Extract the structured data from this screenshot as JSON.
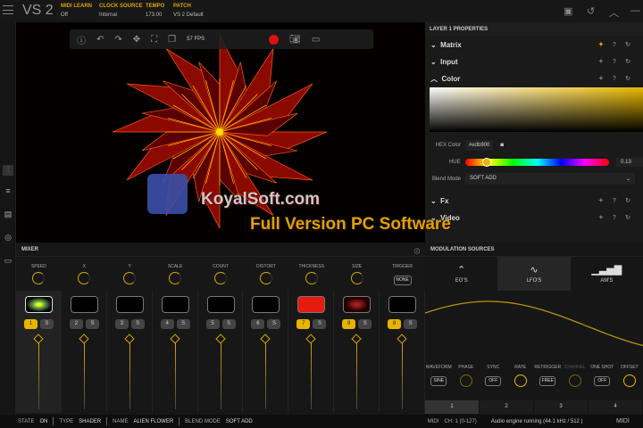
{
  "app": {
    "title": "VS 2"
  },
  "topbar": {
    "fields": [
      {
        "key": "MIDI LEARN",
        "value": "Off"
      },
      {
        "key": "CLOCK SOURCE",
        "value": "Internal"
      },
      {
        "key": "TEMPO",
        "value": "173.00"
      },
      {
        "key": "PATCH",
        "value": "VS 2 Default"
      }
    ]
  },
  "viewport": {
    "fps": "57 FPS",
    "accent": "#ffb300"
  },
  "watermark": {
    "line1": "KoyalSoft.com",
    "line2": "Full Version PC Software"
  },
  "properties": {
    "title": "LAYER 1 PROPERTIES",
    "sections": [
      "Matrix",
      "Input",
      "Color"
    ],
    "hex_label": "HEX Color",
    "hex_value": "#edb900",
    "hue_label": "HUE",
    "hue_value": "0.13",
    "blend_label": "Blend Mode",
    "blend_value": "SOFT ADD",
    "lower_sections": [
      "Fx",
      "Video"
    ]
  },
  "mixer": {
    "title": "MIXER",
    "knobs": [
      "SPEED",
      "X",
      "Y",
      "SCALE",
      "COUNT",
      "DISTORT",
      "THICKNESS",
      "SIZE"
    ],
    "trigger_label": "TRIGGER",
    "trigger_value": "NONE",
    "channels": [
      {
        "num": "1",
        "solo": "S",
        "active": true
      },
      {
        "num": "2",
        "solo": "S",
        "active": false
      },
      {
        "num": "3",
        "solo": "S",
        "active": false
      },
      {
        "num": "4",
        "solo": "S",
        "active": false
      },
      {
        "num": "5",
        "solo": "S",
        "active": false
      },
      {
        "num": "6",
        "solo": "S",
        "active": false
      },
      {
        "num": "7",
        "solo": "S",
        "active": true
      },
      {
        "num": "8",
        "solo": "S",
        "active": true
      },
      {
        "num": "8",
        "solo": "S",
        "active": true
      }
    ]
  },
  "modulation": {
    "title": "MODULATION SOURCES",
    "tabs": [
      "EG'S",
      "LFO'S",
      "AM'S"
    ],
    "controls": [
      {
        "label": "WAVEFORM",
        "value": "SINE"
      },
      {
        "label": "PHASE"
      },
      {
        "label": "SYNC",
        "value": "OFF"
      },
      {
        "label": "RATE"
      },
      {
        "label": "RETRIGGER",
        "value": "FREE"
      },
      {
        "label": "CHANNEL"
      },
      {
        "label": "ONE SHOT",
        "value": "OFF"
      },
      {
        "label": "OFFSET"
      }
    ],
    "slots": [
      "1",
      "2",
      "3",
      "4"
    ]
  },
  "status": {
    "state_k": "STATE",
    "state_v": "ON",
    "type_k": "TYPE",
    "type_v": "SHADER",
    "name_k": "NAME",
    "name_v": "ALIEN FLOWER",
    "blend_k": "BLEND MODE",
    "blend_v": "SOFT ADD",
    "midi": "MIDI",
    "ch": "CH: 1 (0-127)",
    "engine": "Audio engine running (44.1 kHz / 512 )",
    "midi2": "MIDI"
  }
}
